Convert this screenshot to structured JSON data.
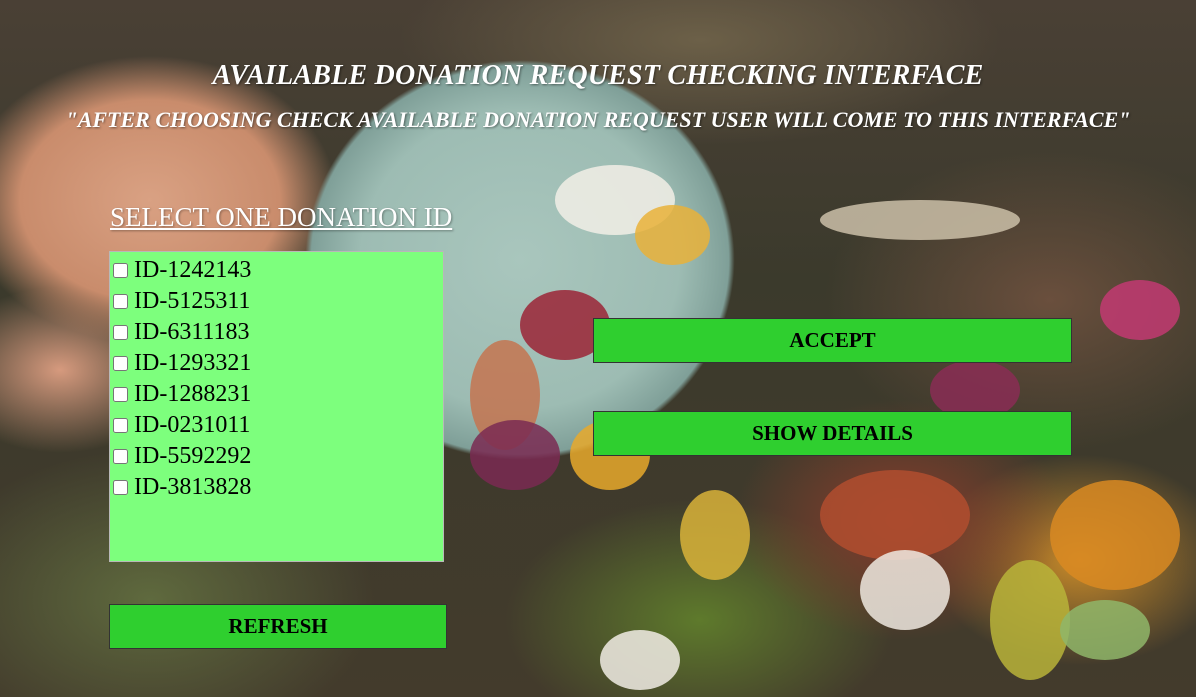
{
  "header": {
    "title": "AVAILABLE DONATION REQUEST CHECKING INTERFACE",
    "subtitle": "\"AFTER CHOOSING CHECK AVAILABLE DONATION REQUEST USER WILL COME TO THIS INTERFACE\""
  },
  "selection": {
    "label": "SELECT ONE DONATION ID ",
    "ids": [
      {
        "label": "ID-1242143",
        "checked": false
      },
      {
        "label": "ID-5125311",
        "checked": false
      },
      {
        "label": "ID-6311183",
        "checked": false
      },
      {
        "label": "ID-1293321",
        "checked": false
      },
      {
        "label": "ID-1288231",
        "checked": false
      },
      {
        "label": "ID-0231011",
        "checked": false
      },
      {
        "label": "ID-5592292",
        "checked": false
      },
      {
        "label": "ID-3813828",
        "checked": false
      }
    ]
  },
  "buttons": {
    "accept": "ACCEPT",
    "show_details": "SHOW DETAILS",
    "refresh": "REFRESH"
  },
  "colors": {
    "list_background": "#7dff7d",
    "button_background": "#2fcf2f",
    "header_text": "#ffffff"
  },
  "background": {
    "icon": "food-waste-photo"
  }
}
